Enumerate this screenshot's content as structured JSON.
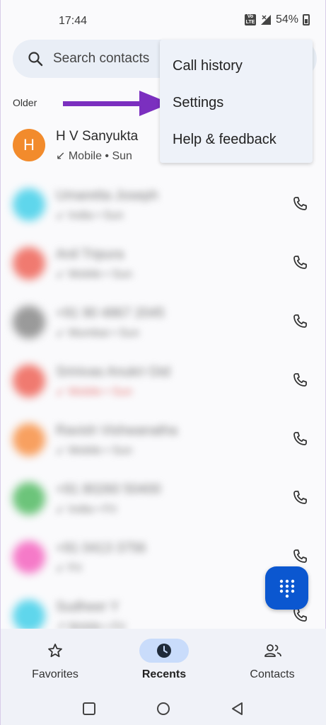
{
  "status_bar": {
    "time": "17:44",
    "battery": "54%"
  },
  "search": {
    "placeholder": "Search contacts"
  },
  "section_label": "Older",
  "recents": [
    {
      "initial": "H",
      "name": "H V Sanyukta",
      "sub": "↙ Mobile • Sun",
      "color": "#f28b2c",
      "blurred": false
    },
    {
      "initial": "",
      "name": "Umaretta Joseph",
      "sub": "↙ India • Sun",
      "color": "#5fd6ec",
      "blurred": true
    },
    {
      "initial": "",
      "name": "Anil Tripura",
      "sub": "↙ Mobile • Sun",
      "color": "#f07a70",
      "blurred": true
    },
    {
      "initial": "",
      "name": "+91 90 4867 2045",
      "sub": "↙ Mumbai • Sun",
      "color": "#9a9a9a",
      "blurred": true
    },
    {
      "initial": "",
      "name": "Srinivas Anukri Gtd",
      "sub": "↙ Mobile • Sun",
      "color": "#f07a70",
      "blurred": true,
      "missed": true
    },
    {
      "initial": "",
      "name": "Ravish Vishwanatha",
      "sub": "↙ Mobile • Sun",
      "color": "#f8a060",
      "blurred": true
    },
    {
      "initial": "",
      "name": "+91 80260 50400",
      "sub": "↙ India • Fri",
      "color": "#6cc47a",
      "blurred": true
    },
    {
      "initial": "",
      "name": "+91 0413 3756",
      "sub": "↙ Fri",
      "color": "#f57ac8",
      "blurred": true
    },
    {
      "initial": "",
      "name": "Sudheer Y",
      "sub": "↗ Mobile • Fri",
      "color": "#5fd6ec",
      "blurred": true
    }
  ],
  "menu": {
    "items": [
      "Call history",
      "Settings",
      "Help & feedback"
    ]
  },
  "bottom_nav": {
    "items": [
      {
        "label": "Favorites",
        "icon": "star-icon"
      },
      {
        "label": "Recents",
        "icon": "clock-icon",
        "active": true
      },
      {
        "label": "Contacts",
        "icon": "people-icon"
      }
    ]
  },
  "colors": {
    "accent": "#0b57d0",
    "annotation_arrow": "#7b2fbf",
    "active_nav_pill": "#c9dcfb"
  }
}
